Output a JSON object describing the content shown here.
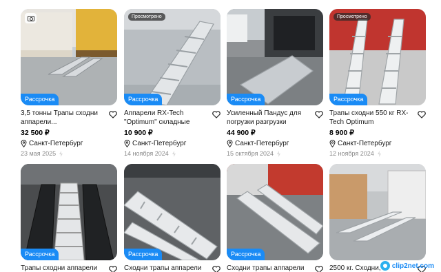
{
  "common": {
    "installment_label": "Рассрочка",
    "seen_label": "Просмотрено",
    "heart_icon": "heart-outline-icon",
    "pin_icon": "location-pin-icon",
    "bolt_icon": "bolt-icon"
  },
  "listings": [
    {
      "title": "3,5 тонны Трапы сходни аппарели...",
      "price": "32 500 ₽",
      "location": "Санкт-Петербург",
      "date": "23 мая 2025"
    },
    {
      "title": "Аппарели RX-Tech \"Optimum\" складные",
      "price": "10 900 ₽",
      "location": "Санкт-Петербург",
      "date": "14 ноября 2024"
    },
    {
      "title": "Усиленный Пандус для погрузки разгрузки",
      "price": "44 900 ₽",
      "location": "Санкт-Петербург",
      "date": "15 октября 2024"
    },
    {
      "title": "Трапы сходни 550 кг RX-Tech Optimum",
      "price": "8 900 ₽",
      "location": "Санкт-Петербург",
      "date": "12 ноября 2024"
    },
    {
      "title": "Трапы сходни аппарели"
    },
    {
      "title": "Сходни трапы аппарели"
    },
    {
      "title": "Сходни трапы аппарели"
    },
    {
      "title": "2500 кг. Сходни,"
    }
  ],
  "watermark": {
    "text": "clip2net.com"
  }
}
